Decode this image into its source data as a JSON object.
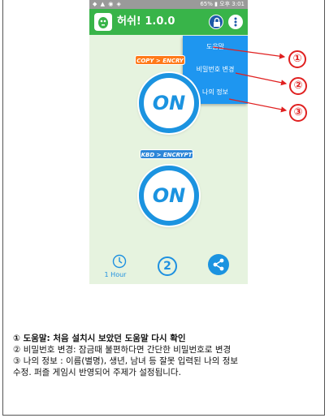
{
  "status_bar": {
    "left_icons": "◆ ▲ ◉ ◈",
    "right_text": "65% ▮ 오후 3:01"
  },
  "app": {
    "title": "허쉬! 1.0.0",
    "accent_color": "#38b449",
    "menu_color": "#1e96f0"
  },
  "menu": {
    "items": [
      {
        "label": "도움말"
      },
      {
        "label": "비밀번호 변경"
      },
      {
        "label": "나의 정보"
      }
    ]
  },
  "main": {
    "copy_banner": "COPY > ENCRY",
    "kbd_banner": "KBD > ENCRYPT",
    "on_label": "ON",
    "on_label_2": "ON",
    "timer_label": "1 Hour",
    "bottom_number": "2"
  },
  "callouts": [
    {
      "label": "①"
    },
    {
      "label": "②"
    },
    {
      "label": "③"
    }
  ],
  "notes": {
    "line1": "① 도움말: 처음 설치시 보았던 도움말 다시 확인",
    "line2": "② 비밀번호 변경: 잠금때 불편하다면 간단한 비밀번호로 변경",
    "line3": "③ 나의 정보 : 이름(별명), 생년, 남녀 등 잘못 입력된 나의 정보",
    "line4": "수정.   퍼즐 게임시 반영되어 주제가 설정됩니다."
  }
}
